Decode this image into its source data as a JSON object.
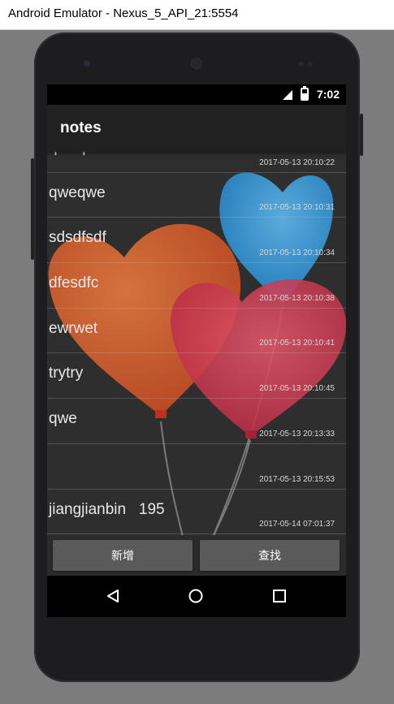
{
  "window": {
    "title": "Android Emulator - Nexus_5_API_21:5554"
  },
  "status": {
    "time": "7:02"
  },
  "app": {
    "title": "notes"
  },
  "notes": [
    {
      "text": "qweqwe",
      "time": "2017-05-13 20:10:22"
    },
    {
      "text": "qweqwe",
      "time": "2017-05-13 20:10:31"
    },
    {
      "text": "sdsdfsdf",
      "time": "2017-05-13 20:10:34"
    },
    {
      "text": "dfesdfc",
      "time": "2017-05-13 20:10:38"
    },
    {
      "text": "ewrwet",
      "time": "2017-05-13 20:10:41"
    },
    {
      "text": "trytry",
      "time": "2017-05-13 20:10:45"
    },
    {
      "text": "qwe",
      "time": "2017-05-13 20:13:33"
    },
    {
      "text": "",
      "time": "2017-05-13 20:15:53"
    },
    {
      "text": "jiangjianbin   195",
      "time": "2017-05-14 07:01:37"
    }
  ],
  "buttons": {
    "add": "新增",
    "find": "查找"
  },
  "icons": {
    "signal": "signal-icon",
    "battery": "battery-charging-icon",
    "back": "back-triangle-icon",
    "home": "home-circle-icon",
    "recent": "recent-square-icon"
  },
  "colors": {
    "balloon_orange": "#d4562a",
    "balloon_red": "#d23a4c",
    "balloon_blue": "#2f95d6"
  }
}
